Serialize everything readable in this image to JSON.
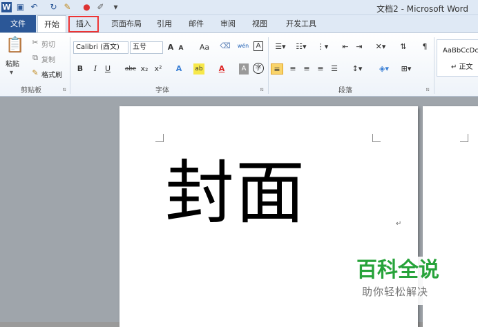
{
  "window": {
    "title": "文档2 - Microsoft Word"
  },
  "quick_access": [
    {
      "icon": "word-app-icon",
      "glyph": "W"
    },
    {
      "icon": "save-icon",
      "glyph": "▣"
    },
    {
      "icon": "undo-icon",
      "glyph": "↶"
    },
    {
      "icon": "redo-icon",
      "glyph": "↻"
    },
    {
      "icon": "format-painter-icon",
      "glyph": "✎"
    },
    {
      "icon": "color-icon",
      "glyph": "●"
    },
    {
      "icon": "pen-icon",
      "glyph": "✐"
    },
    {
      "icon": "customize-icon",
      "glyph": "▾"
    }
  ],
  "tabs": [
    "文件",
    "开始",
    "插入",
    "页面布局",
    "引用",
    "邮件",
    "审阅",
    "视图",
    "开发工具"
  ],
  "ribbon": {
    "clipboard": {
      "paste": "粘贴",
      "cut": "剪切",
      "copy": "复制",
      "format_painter": "格式刷",
      "label": "剪贴板"
    },
    "font": {
      "font_name": "Calibri (西文)",
      "font_size": "五号",
      "grow": "A",
      "shrink": "A",
      "case": "Aa",
      "label": "字体",
      "bold": "B",
      "italic": "I",
      "underline": "U",
      "strike": "abc",
      "subscript": "x₂",
      "superscript": "x²",
      "font_color": "A",
      "char_shade": "A",
      "enclose": "字",
      "phonetic": "wén",
      "char_border": "A"
    },
    "paragraph": {
      "label": "段落"
    },
    "styles": {
      "sample": "AaBbCcDc",
      "normal": "↵ 正文"
    }
  },
  "document": {
    "cover_text": "封面",
    "para_mark": "↵"
  },
  "watermark": {
    "title": "百科全说",
    "subtitle": "助你轻松解决"
  },
  "colors": {
    "file_tab": "#2b5797",
    "highlight_box": "#ee3333",
    "watermark_green": "#27a33a"
  }
}
